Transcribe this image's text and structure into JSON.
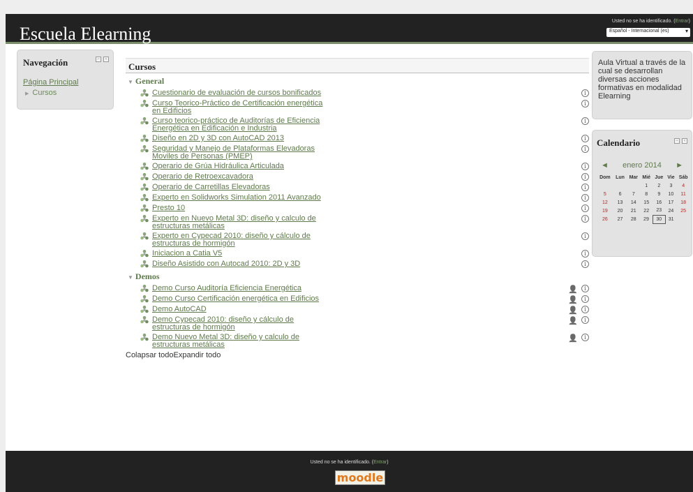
{
  "header": {
    "site_title": "Escuela Elearning",
    "login_text": "Usted no se ha identificado. (",
    "login_link": "Entrar",
    "login_close": ")",
    "language": "Español - Internacional (es)"
  },
  "nav_block": {
    "title": "Navegación",
    "home": "Página Principal",
    "courses": "Cursos"
  },
  "main": {
    "title": "Cursos",
    "categories": [
      {
        "name": "General",
        "courses": [
          {
            "name": "Cuestionario de evaluación de cursos bonificados",
            "guest": false
          },
          {
            "name": "Curso Teorico-Práctico de Certificación energética en Edificios",
            "guest": false
          },
          {
            "name": "Curso teorico-práctico de Auditorías de Eficiencia Energética en Edificación e Industria",
            "guest": false
          },
          {
            "name": "Diseño en 2D y 3D con AutoCAD 2013",
            "guest": false
          },
          {
            "name": "Seguridad y Manejo de Plataformas Elevadoras Moviles de Personas (PMEP)",
            "guest": false
          },
          {
            "name": "Operario de Grúa Hidráulica Articulada",
            "guest": false
          },
          {
            "name": "Operario de Retroexcavadora",
            "guest": false
          },
          {
            "name": "Operario de Carretillas Elevadoras",
            "guest": false
          },
          {
            "name": "Experto en Solidworks Simulation 2011 Avanzado",
            "guest": false
          },
          {
            "name": "Presto 10",
            "guest": false
          },
          {
            "name": "Experto en Nuevo Metal 3D: diseño y calculo de estructuras metálicas",
            "guest": false
          },
          {
            "name": "Experto en Cypecad 2010: diseño y cálculo de estructuras de hormigón",
            "guest": false
          },
          {
            "name": "Iniciacion a Catia V5",
            "guest": false
          },
          {
            "name": "Diseño Asistido con Autocad 2010: 2D y 3D",
            "guest": false
          }
        ]
      },
      {
        "name": "Demos",
        "courses": [
          {
            "name": "Demo Curso Auditoría Eficiencia Energética",
            "guest": true
          },
          {
            "name": "Demo Curso Certificación energética en Edificios",
            "guest": true
          },
          {
            "name": "Demo AutoCAD",
            "guest": true
          },
          {
            "name": "Demo Cypecad 2010: diseño y cálculo de estructuras de hormigón",
            "guest": true
          },
          {
            "name": "Demo Nuevo Metal 3D: diseño y calculo de estructuras metálicas",
            "guest": true
          }
        ]
      }
    ],
    "collapse_all": "Colapsar todo",
    "expand_all": "Expandir todo"
  },
  "aula_block": {
    "text": "Aula Virtual a través de la cual se desarrollan diversas acciones formativas en modalidad Elearning"
  },
  "calendar": {
    "title": "Calendario",
    "prev": "◄",
    "next": "►",
    "month": "enero 2014",
    "days": [
      "Dom",
      "Lun",
      "Mar",
      "Mié",
      "Jue",
      "Vie",
      "Sáb"
    ],
    "weeks": [
      [
        "",
        "",
        "",
        "1",
        "2",
        "3",
        "4"
      ],
      [
        "5",
        "6",
        "7",
        "8",
        "9",
        "10",
        "11"
      ],
      [
        "12",
        "13",
        "14",
        "15",
        "16",
        "17",
        "18"
      ],
      [
        "19",
        "20",
        "21",
        "22",
        "23",
        "24",
        "25"
      ],
      [
        "26",
        "27",
        "28",
        "29",
        "30",
        "31",
        ""
      ]
    ],
    "today": "30"
  },
  "footer": {
    "login_text": "Usted no se ha identificado. (",
    "login_link": "Entrar",
    "login_close": ")",
    "logo_text": "moodle"
  },
  "colors": {
    "link_green": "#5f7a4c",
    "header_bg": "#222222",
    "weekend_red": "#bb2222"
  }
}
